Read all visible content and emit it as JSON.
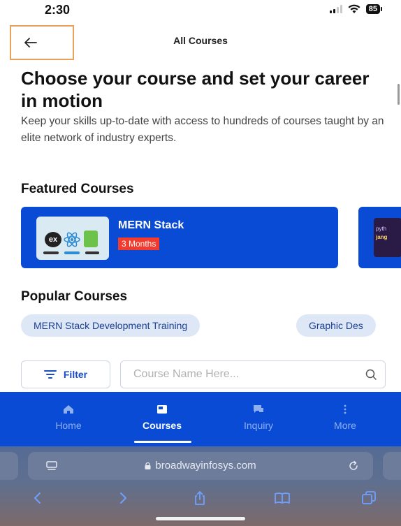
{
  "status_bar": {
    "time": "2:30",
    "battery": "85"
  },
  "header": {
    "title": "All Courses"
  },
  "hero": {
    "title": "Choose your course and set your career in motion",
    "description": "Keep your skills up-to-date with access to hundreds of courses taught by an elite network of industry experts."
  },
  "featured": {
    "title": "Featured Courses",
    "cards": [
      {
        "name": "MERN Stack",
        "duration": "3 Months",
        "thumb_text": "ex"
      },
      {
        "thumb_text_1": "pyth",
        "thumb_text_2": "jang"
      }
    ]
  },
  "popular": {
    "title": "Popular Courses",
    "chips": [
      "MERN Stack Development Training",
      "Graphic Des"
    ]
  },
  "filter": {
    "label": "Filter"
  },
  "search": {
    "placeholder": "Course Name Here..."
  },
  "bottom_nav": {
    "items": [
      {
        "label": "Home",
        "icon": "home-icon"
      },
      {
        "label": "Courses",
        "icon": "courses-icon",
        "active": true
      },
      {
        "label": "Inquiry",
        "icon": "inquiry-icon"
      },
      {
        "label": "More",
        "icon": "more-icon"
      }
    ]
  },
  "browser": {
    "url": "broadwayinfosys.com"
  },
  "colors": {
    "primary": "#0a4bd6",
    "badge": "#f23b2f",
    "chip_bg": "#dde7f6",
    "highlight_border": "#e8a25c"
  }
}
